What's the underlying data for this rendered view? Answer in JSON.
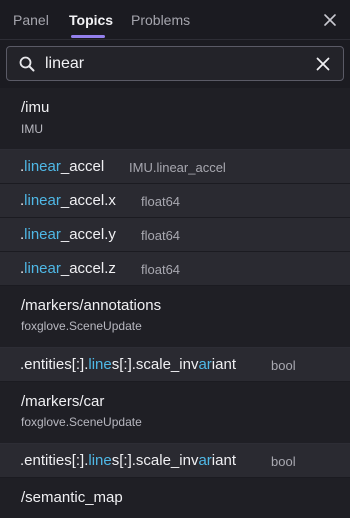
{
  "tabs": [
    {
      "label": "Panel"
    },
    {
      "label": "Topics"
    },
    {
      "label": "Problems"
    }
  ],
  "search": {
    "value": "linear",
    "placeholder": ""
  },
  "topics": [
    {
      "name": "/imu",
      "type": "IMU",
      "fields": [
        {
          "pre": ".",
          "match": "linear",
          "post": "_accel",
          "type": "IMU.linear_accel"
        },
        {
          "pre": ".",
          "match": "linear",
          "post": "_accel.x",
          "type": "float64"
        },
        {
          "pre": ".",
          "match": "linear",
          "post": "_accel.y",
          "type": "float64"
        },
        {
          "pre": ".",
          "match": "linear",
          "post": "_accel.z",
          "type": "float64"
        }
      ]
    },
    {
      "name": "/markers/annotations",
      "type": "foxglove.SceneUpdate",
      "fields": [
        {
          "segments": [
            ".entities[:].",
            "line",
            "s[:].scale_inv",
            "ar",
            "iant"
          ],
          "type": "bool"
        }
      ]
    },
    {
      "name": "/markers/car",
      "type": "foxglove.SceneUpdate",
      "fields": [
        {
          "segments": [
            ".entities[:].",
            "line",
            "s[:].scale_inv",
            "ar",
            "iant"
          ],
          "type": "bool"
        }
      ]
    },
    {
      "name": "/semantic_map",
      "type": "",
      "fields": []
    }
  ],
  "colors": {
    "accent": "#9480ed",
    "highlight": "#4fb8e6"
  }
}
